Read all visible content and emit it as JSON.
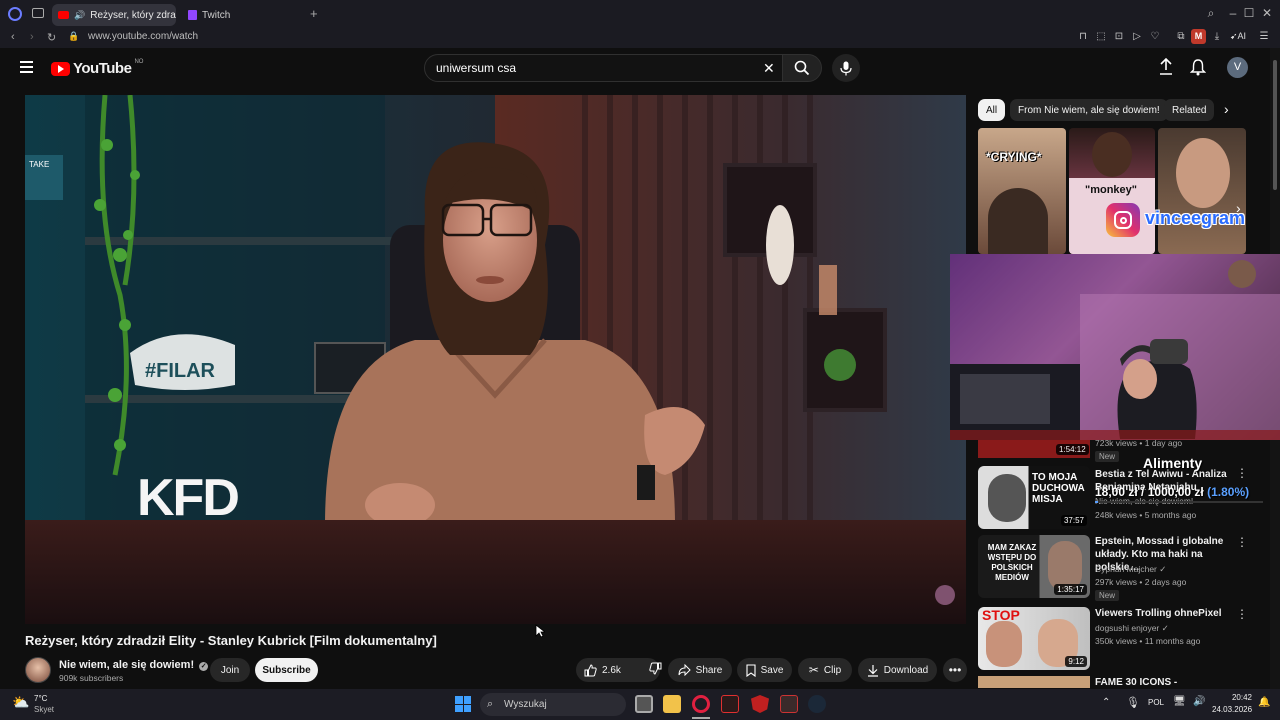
{
  "browser": {
    "tabs": [
      {
        "label": "Reżyser, który zdradził",
        "active": true
      },
      {
        "label": "Twitch",
        "active": false
      }
    ],
    "new_tab_symbol": "+",
    "url": "www.youtube.com/watch",
    "ai_label": "AI",
    "profile_letter": "M"
  },
  "youtube": {
    "logo_text": "YouTube",
    "region": "NO",
    "search_value": "uniwersum csa",
    "avatar_letter": "V"
  },
  "video": {
    "overlay_logo": "KFD",
    "cap_text": "#FILAR",
    "sign_text": "TAKE",
    "title": "Reżyser, który zdradził Elity - Stanley Kubrick [Film dokumentalny]",
    "channel": "Nie wiem, ale się dowiem!",
    "subscribers": "909k subscribers",
    "join_label": "Join",
    "subscribe_label": "Subscribe",
    "likes": "2.6k",
    "share_label": "Share",
    "save_label": "Save",
    "clip_label": "Clip",
    "download_label": "Download"
  },
  "chips": [
    "All",
    "From Nie wiem, ale się dowiem!",
    "Related"
  ],
  "overlay": {
    "crying_text": "*CRYING*",
    "monkey_text": "\"monkey\"",
    "instagram_handle": "vinceegram",
    "donation_title": "Alimenty",
    "donation_current": "18,00 zł",
    "donation_goal": "1000,00 zł",
    "donation_percent": "(1.80%)",
    "donation_fraction": 0.018
  },
  "recommendations": [
    {
      "title": "",
      "channel": "",
      "meta": "723k views • 1 day ago",
      "badge": "New",
      "duration": "1:54:12",
      "thumb_text": ""
    },
    {
      "title": "Bestia z Tel Awiwu - Analiza Benjamina Netanjahu",
      "channel": "Nie wiem, ale się dowiem!",
      "meta": "248k views • 5 months ago",
      "badge": "",
      "duration": "37:57",
      "thumb_text": "TO MOJA DUCHOWA MISJA"
    },
    {
      "title": "Epstein, Mossad i globalne układy. Kto ma haki na polskie…",
      "channel": "Cyprian Majcher",
      "meta": "297k views • 2 days ago",
      "badge": "New",
      "duration": "1:35:17",
      "thumb_text": "MAM ZAKAZ WSTĘPU DO POLSKICH MEDIÓW"
    },
    {
      "title": "Viewers Trolling ohnePixel",
      "channel": "dogsushi enjoyer",
      "meta": "350k views • 11 months ago",
      "badge": "",
      "duration": "9:12",
      "thumb_text": "STOP"
    },
    {
      "title": "FAME 30 ICONS -",
      "channel": "",
      "meta": "",
      "badge": "",
      "duration": "",
      "thumb_text": ""
    }
  ],
  "taskbar": {
    "weather_temp": "7°C",
    "weather_desc": "Skyet",
    "search_placeholder": "Wyszukaj",
    "language": "POL",
    "time": "20:42",
    "date": "24.03.2026"
  },
  "colors": {
    "yt_red": "#ff0000",
    "bg": "#0f0f0f",
    "chip_bg": "#272727",
    "donation_blue": "#5aa0ff"
  }
}
